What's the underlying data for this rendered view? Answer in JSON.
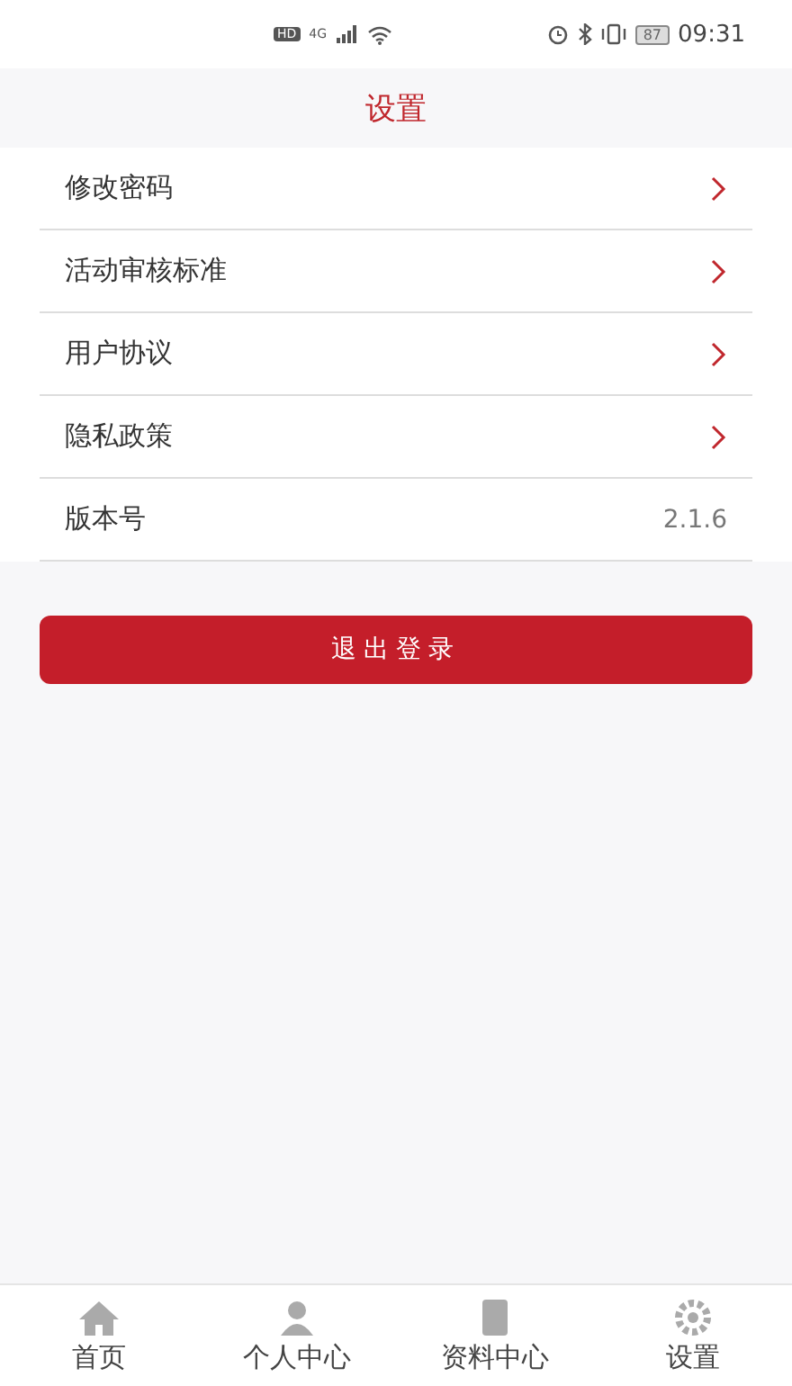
{
  "status_bar": {
    "hd": "HD",
    "network": "4G",
    "battery": "87",
    "time": "09:31"
  },
  "header": {
    "title": "设置"
  },
  "settings": [
    {
      "label": "修改密码",
      "kind": "link"
    },
    {
      "label": "活动审核标准",
      "kind": "link"
    },
    {
      "label": "用户协议",
      "kind": "link"
    },
    {
      "label": "隐私政策",
      "kind": "link"
    },
    {
      "label": "版本号",
      "kind": "value",
      "value": "2.1.6"
    }
  ],
  "logout_button": "退出登录",
  "tab_bar": [
    {
      "label": "首页",
      "selected": false
    },
    {
      "label": "个人中心",
      "selected": false
    },
    {
      "label": "资料中心",
      "selected": false
    },
    {
      "label": "设置",
      "selected": false
    }
  ]
}
